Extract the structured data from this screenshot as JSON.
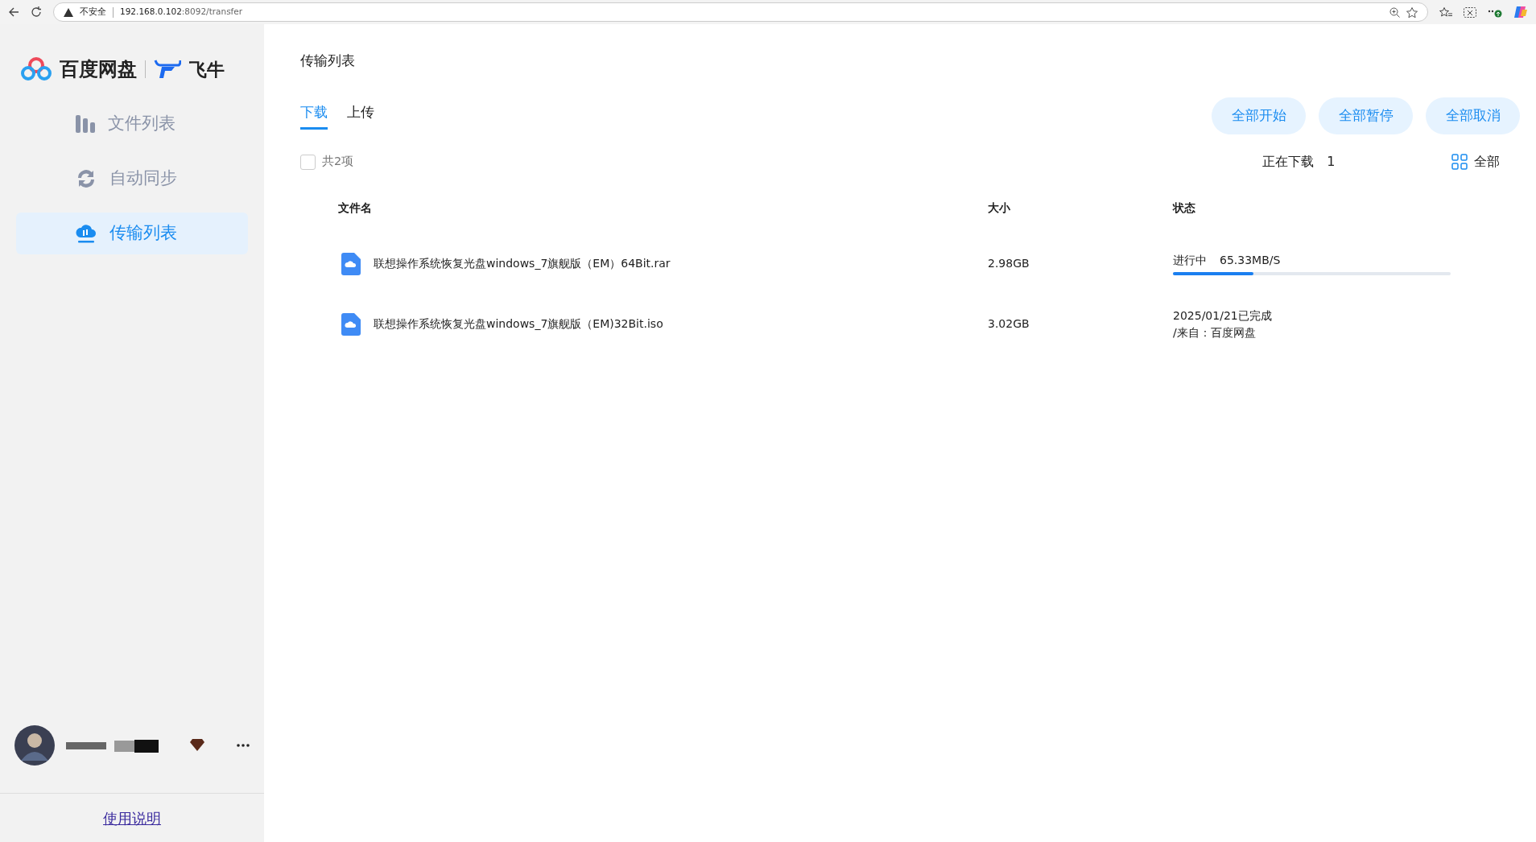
{
  "browser": {
    "security": "不安全",
    "url_host": "192.168.0.102",
    "url_rest": ":8092/transfer"
  },
  "sidebar": {
    "brand": "百度网盘",
    "partner": "飞牛",
    "items": [
      {
        "label": "文件列表",
        "selected": false
      },
      {
        "label": "自动同步",
        "selected": false
      },
      {
        "label": "传输列表",
        "selected": true
      }
    ],
    "help_link": "使用说明"
  },
  "main": {
    "title": "传输列表",
    "tabs": [
      {
        "label": "下载",
        "selected": true
      },
      {
        "label": "上传",
        "selected": false
      }
    ],
    "buttons": [
      "全部开始",
      "全部暂停",
      "全部取消"
    ],
    "select_all": {
      "checked": false,
      "label": "共2项"
    },
    "downloading": {
      "label": "正在下载",
      "count": "1"
    },
    "filter": "全部",
    "table": {
      "columns": [
        "文件名",
        "大小",
        "状态"
      ],
      "rows": [
        {
          "name": "联想操作系统恢复光盘windows_7旗舰版（EM）64Bit.rar",
          "size": "2.98GB",
          "kind": "progress",
          "status": "进行中",
          "speed": "65.33MB/S",
          "level": 0.29
        },
        {
          "name": "联想操作系统恢复光盘windows_7旗舰版（EM)32Bit.iso",
          "size": "3.02GB",
          "kind": "done",
          "status": "2025/01/21已完成",
          "source": "/来自：百度网盘"
        }
      ]
    }
  }
}
